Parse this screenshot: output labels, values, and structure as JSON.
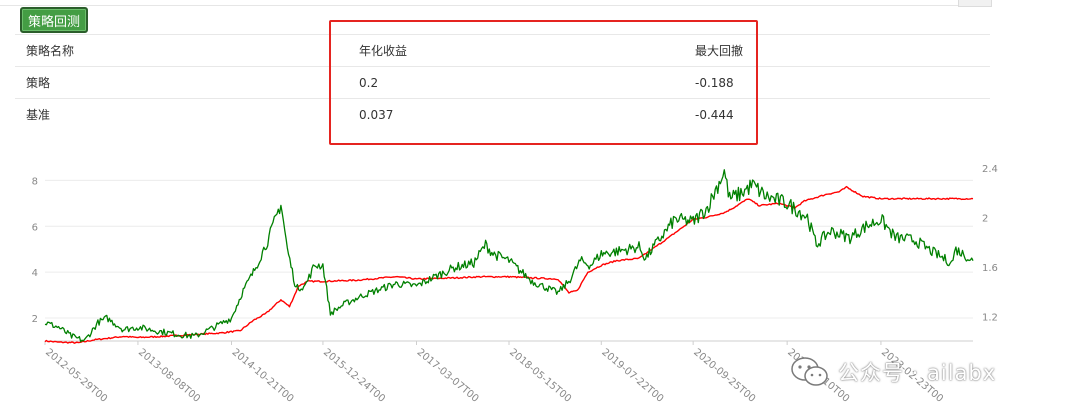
{
  "toolbar": {
    "run_label": "策略回测"
  },
  "summary": {
    "headers": [
      "策略名称",
      "年化收益",
      "最大回撤"
    ],
    "rows": [
      {
        "name": "策略",
        "annual_return": "0.2",
        "max_drawdown": "-0.188"
      },
      {
        "name": "基准",
        "annual_return": "0.037",
        "max_drawdown": "-0.444"
      }
    ]
  },
  "highlight_color": "#e52420",
  "watermark": {
    "icon": "wechat-icon",
    "text": "公众号 · ailabx"
  },
  "chart_data": {
    "type": "line",
    "y_left": {
      "ticks": [
        "2",
        "4",
        "6",
        "8"
      ],
      "range": [
        1,
        8.8
      ]
    },
    "y_right": {
      "ticks": [
        "1.2",
        "1.6",
        "2",
        "2.4"
      ],
      "range": [
        1.0,
        2.45
      ]
    },
    "x_ticks": [
      "2012-05-29T00",
      "2013-08-08T00",
      "2014-10-21T00",
      "2015-12-24T00",
      "2017-03-07T00",
      "2018-05-15T00",
      "2019-07-22T00",
      "2020-09-25T00",
      "2021-12-10T00",
      "2023-02-23T00"
    ],
    "x_range": [
      "2012-05-29",
      "2024-04-30"
    ],
    "grid": true,
    "series": [
      {
        "color": "#ff0000",
        "axis": "left",
        "points": [
          [
            "2012-05-29",
            1.0
          ],
          [
            "2012-08-01",
            0.95
          ],
          [
            "2012-11-01",
            0.92
          ],
          [
            "2013-01-15",
            1.05
          ],
          [
            "2013-06-01",
            1.2
          ],
          [
            "2013-08-08",
            1.15
          ],
          [
            "2013-12-01",
            1.2
          ],
          [
            "2014-03-01",
            1.25
          ],
          [
            "2014-06-01",
            1.3
          ],
          [
            "2014-09-01",
            1.35
          ],
          [
            "2014-12-01",
            1.45
          ],
          [
            "2015-02-01",
            1.9
          ],
          [
            "2015-04-01",
            2.2
          ],
          [
            "2015-06-10",
            2.8
          ],
          [
            "2015-07-20",
            2.5
          ],
          [
            "2015-09-01",
            3.4
          ],
          [
            "2015-10-15",
            3.6
          ],
          [
            "2015-12-24",
            3.6
          ],
          [
            "2016-06-01",
            3.65
          ],
          [
            "2016-12-01",
            3.8
          ],
          [
            "2017-03-07",
            3.7
          ],
          [
            "2017-09-01",
            3.75
          ],
          [
            "2018-01-01",
            3.8
          ],
          [
            "2018-05-15",
            3.8
          ],
          [
            "2018-09-01",
            3.75
          ],
          [
            "2018-12-31",
            3.7
          ],
          [
            "2019-02-20",
            3.1
          ],
          [
            "2019-04-01",
            3.2
          ],
          [
            "2019-05-20",
            4.0
          ],
          [
            "2019-07-22",
            4.3
          ],
          [
            "2019-10-01",
            4.5
          ],
          [
            "2020-01-15",
            4.6
          ],
          [
            "2020-03-01",
            4.9
          ],
          [
            "2020-06-01",
            5.5
          ],
          [
            "2020-07-15",
            5.8
          ],
          [
            "2020-09-25",
            6.3
          ],
          [
            "2020-12-01",
            6.4
          ],
          [
            "2021-02-20",
            6.6
          ],
          [
            "2021-04-01",
            6.8
          ],
          [
            "2021-06-10",
            7.2
          ],
          [
            "2021-08-01",
            6.9
          ],
          [
            "2021-11-01",
            7.0
          ],
          [
            "2022-01-15",
            6.8
          ],
          [
            "2022-03-01",
            7.1
          ],
          [
            "2022-06-15",
            7.4
          ],
          [
            "2022-08-10",
            7.5
          ],
          [
            "2022-09-15",
            7.7
          ],
          [
            "2022-12-01",
            7.3
          ],
          [
            "2023-02-23",
            7.2
          ],
          [
            "2023-06-01",
            7.2
          ],
          [
            "2024-04-30",
            7.2
          ]
        ]
      },
      {
        "color": "#008000",
        "axis": "left",
        "points": [
          [
            "2012-05-29",
            1.8
          ],
          [
            "2012-08-01",
            1.6
          ],
          [
            "2012-10-01",
            1.2
          ],
          [
            "2012-12-01",
            1.0
          ],
          [
            "2013-02-01",
            1.8
          ],
          [
            "2013-03-15",
            2.0
          ],
          [
            "2013-06-01",
            1.5
          ],
          [
            "2013-08-08",
            1.6
          ],
          [
            "2013-11-01",
            1.45
          ],
          [
            "2014-02-01",
            1.3
          ],
          [
            "2014-05-01",
            1.2
          ],
          [
            "2014-08-01",
            1.6
          ],
          [
            "2014-10-21",
            2.0
          ],
          [
            "2014-12-15",
            3.2
          ],
          [
            "2015-02-01",
            4.0
          ],
          [
            "2015-04-15",
            5.5
          ],
          [
            "2015-06-10",
            7.0
          ],
          [
            "2015-07-10",
            5.0
          ],
          [
            "2015-08-20",
            3.3
          ],
          [
            "2015-10-01",
            3.4
          ],
          [
            "2015-11-15",
            4.3
          ],
          [
            "2015-12-24",
            4.3
          ],
          [
            "2016-01-28",
            2.2
          ],
          [
            "2016-04-01",
            2.6
          ],
          [
            "2016-07-01",
            3.0
          ],
          [
            "2016-10-01",
            3.3
          ],
          [
            "2016-12-01",
            3.5
          ],
          [
            "2017-03-07",
            3.4
          ],
          [
            "2017-06-01",
            3.8
          ],
          [
            "2017-09-01",
            4.2
          ],
          [
            "2017-12-01",
            4.4
          ],
          [
            "2018-01-25",
            5.2
          ],
          [
            "2018-03-01",
            4.8
          ],
          [
            "2018-05-15",
            4.5
          ],
          [
            "2018-07-01",
            4.1
          ],
          [
            "2018-09-01",
            3.6
          ],
          [
            "2018-12-31",
            3.1
          ],
          [
            "2019-02-20",
            3.6
          ],
          [
            "2019-04-15",
            4.5
          ],
          [
            "2019-06-01",
            4.3
          ],
          [
            "2019-07-22",
            4.8
          ],
          [
            "2019-10-01",
            4.9
          ],
          [
            "2020-01-15",
            5.1
          ],
          [
            "2020-02-15",
            4.6
          ],
          [
            "2020-04-01",
            5.2
          ],
          [
            "2020-07-01",
            6.3
          ],
          [
            "2020-09-25",
            6.2
          ],
          [
            "2020-12-01",
            6.8
          ],
          [
            "2021-02-18",
            8.4
          ],
          [
            "2021-03-15",
            7.2
          ],
          [
            "2021-05-01",
            7.4
          ],
          [
            "2021-07-01",
            7.8
          ],
          [
            "2021-09-01",
            7.3
          ],
          [
            "2021-12-10",
            7.0
          ],
          [
            "2022-03-15",
            6.4
          ],
          [
            "2022-04-26",
            5.2
          ],
          [
            "2022-07-01",
            5.8
          ],
          [
            "2022-10-01",
            5.5
          ],
          [
            "2022-12-15",
            6.0
          ],
          [
            "2023-02-23",
            6.3
          ],
          [
            "2023-05-01",
            5.5
          ],
          [
            "2023-08-01",
            5.4
          ],
          [
            "2023-10-20",
            4.9
          ],
          [
            "2024-01-20",
            4.4
          ],
          [
            "2024-02-10",
            5.0
          ],
          [
            "2024-04-30",
            4.5
          ]
        ]
      }
    ]
  }
}
